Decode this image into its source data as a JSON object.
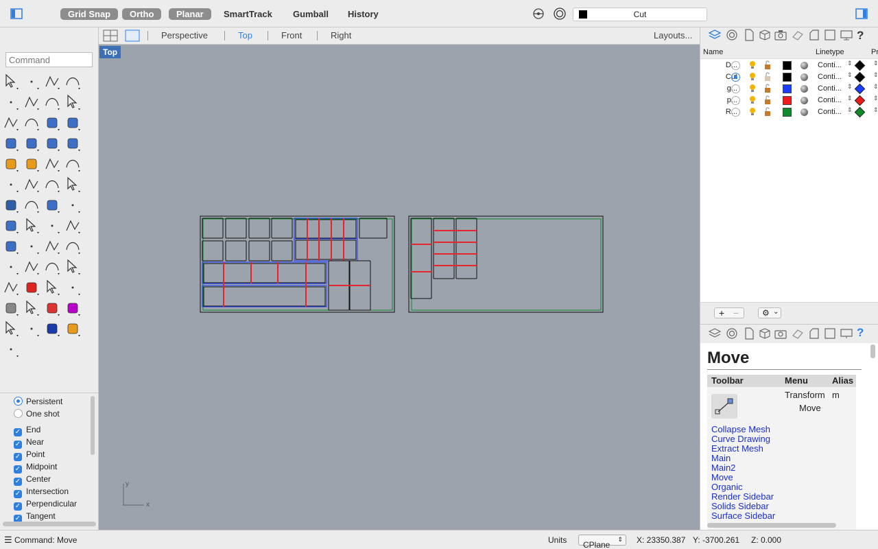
{
  "topbar": {
    "toggles": [
      {
        "label": "Grid Snap",
        "active": true
      },
      {
        "label": "Ortho",
        "active": true
      },
      {
        "label": "Planar",
        "active": true
      },
      {
        "label": "SmartTrack",
        "active": false
      },
      {
        "label": "Gumball",
        "active": false
      },
      {
        "label": "History",
        "active": false
      }
    ],
    "current_layer": "Cut"
  },
  "command": {
    "placeholder": "Command"
  },
  "viewport_tabs": {
    "tabs": [
      "Perspective",
      "Top",
      "Front",
      "Right"
    ],
    "active": "Top",
    "layouts": "Layouts..."
  },
  "viewport": {
    "label": "Top",
    "axis_x": "x",
    "axis_y": "y"
  },
  "osnap": {
    "modes": [
      "Persistent",
      "One shot"
    ],
    "selected_mode": "Persistent",
    "snaps": [
      "End",
      "Near",
      "Point",
      "Midpoint",
      "Center",
      "Intersection",
      "Perpendicular",
      "Tangent"
    ]
  },
  "layers": {
    "col_name": "Name",
    "col_linetype": "Linetype",
    "col_print": "Pr",
    "rows": [
      {
        "name": "D...",
        "current": false,
        "color": "#000000",
        "linetype": "Conti...",
        "print_color": "#000000"
      },
      {
        "name": "Cut",
        "current": true,
        "color": "#000000",
        "linetype": "Conti...",
        "print_color": "#000000"
      },
      {
        "name": "g...",
        "current": false,
        "color": "#1a3cff",
        "linetype": "Conti...",
        "print_color": "#1a3cff"
      },
      {
        "name": "p...",
        "current": false,
        "color": "#ee1c1c",
        "linetype": "Conti...",
        "print_color": "#ee1c1c"
      },
      {
        "name": "R...",
        "current": false,
        "color": "#0f8a2a",
        "linetype": "Conti...",
        "print_color": "#0f8a2a"
      }
    ],
    "add": "+",
    "remove": "−"
  },
  "help": {
    "title": "Move",
    "header_toolbar": "Toolbar",
    "header_menu": "Menu",
    "header_alias": "Alias",
    "menu_line1": "Transform",
    "menu_line2": "Move",
    "alias": "m",
    "toolbars": [
      "Collapse Mesh",
      "Curve Drawing",
      "Extract Mesh",
      "Main",
      "Main2",
      "Move",
      "Organic",
      "Render Sidebar",
      "Solids Sidebar",
      "Surface Sidebar"
    ]
  },
  "status": {
    "command": "Command: Move",
    "units": "Units",
    "cplane": "CPlane",
    "x": "X: 23350.387",
    "y": "Y: -3700.261",
    "z": "Z: 0.000"
  },
  "colors": {
    "accent": "#2f7fe0",
    "viewport_bg": "#9ca3ad",
    "cut_red": "#e3262b",
    "green_border": "#0f8a2a",
    "blue_line": "#1a3cff"
  }
}
